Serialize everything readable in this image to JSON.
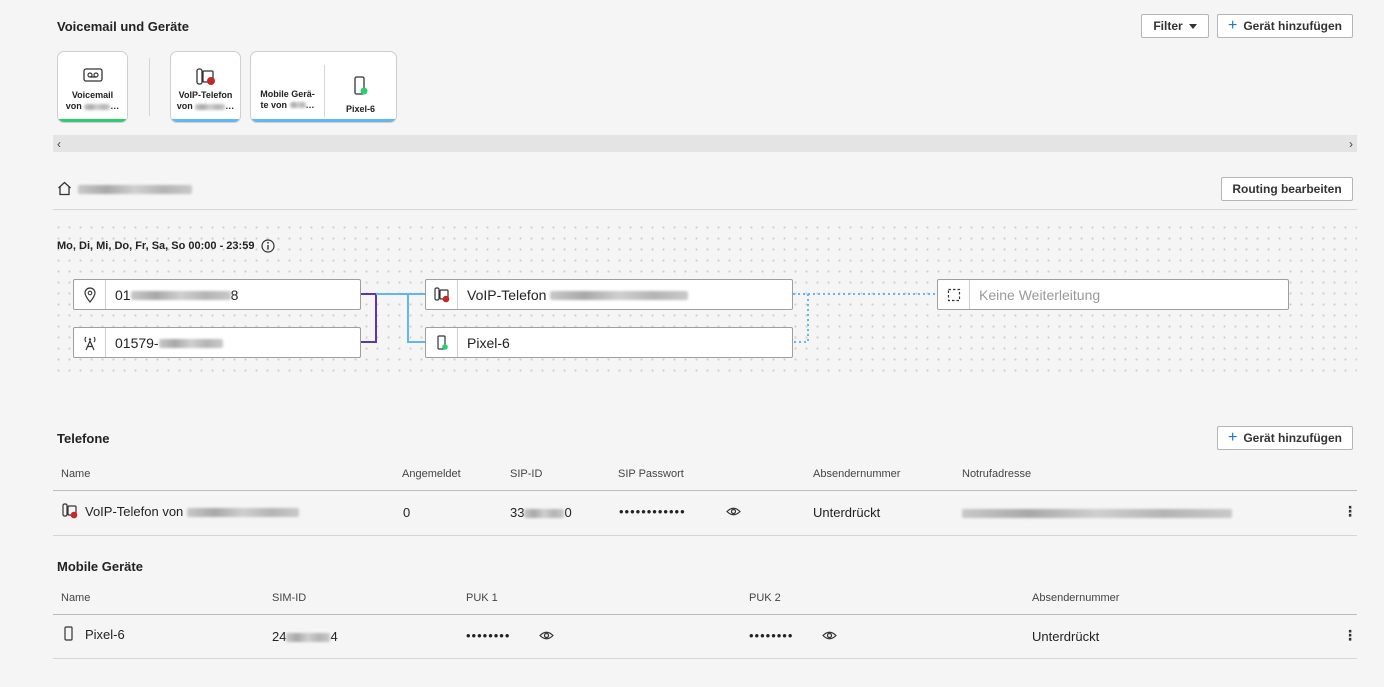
{
  "section": {
    "title": "Voicemail und Geräte",
    "filter_label": "Filter",
    "add_device_label": "Gerät hinzufügen"
  },
  "cards": {
    "voicemail": {
      "line1": "Voicemail",
      "line2": "von",
      "line2_suffix": "…"
    },
    "voip": {
      "line1": "VoIP-Telefon",
      "line2": "von",
      "line2_suffix": "…"
    },
    "mobile": {
      "line1": "Mobile Gerä-",
      "line2": "te von",
      "line2_suffix": "…",
      "device": "Pixel-6"
    }
  },
  "scrollbar": {
    "left": "‹",
    "right": "›"
  },
  "routing": {
    "title_icon": "home-icon",
    "edit_label": "Routing bearbeiten",
    "schedule": "Mo, Di, Mi, Do, Fr, Sa, So 00:00 - 23:59",
    "number1_prefix": "01",
    "number1_suffix": "8",
    "number2_prefix": "01579-",
    "target1": "VoIP-Telefon",
    "target2": "Pixel-6",
    "forward": "Keine Weiterleitung"
  },
  "phones": {
    "title": "Telefone",
    "add_label": "Gerät hinzufügen",
    "headers": [
      "Name",
      "Angemeldet",
      "SIP-ID",
      "SIP Passwort",
      "Absendernummer",
      "Notrufadresse"
    ],
    "row": {
      "name": "VoIP-Telefon von",
      "angemeldet": "0",
      "sip_prefix": "33",
      "sip_suffix": "0",
      "password": "••••••••••••",
      "absender": "Unterdrückt"
    }
  },
  "mobile": {
    "title": "Mobile Geräte",
    "headers": [
      "Name",
      "SIM-ID",
      "PUK 1",
      "PUK 2",
      "Absendernummer"
    ],
    "row": {
      "name": "Pixel-6",
      "sim_prefix": "24",
      "sim_suffix": "4",
      "puk1": "••••••••",
      "puk2": "••••••••",
      "absender": "Unterdrückt"
    }
  },
  "colors": {
    "green": "#2ecc71",
    "blue": "#64b5f6",
    "purple": "#5e35b1",
    "link_blue": "#1976d2",
    "red": "#c62828"
  }
}
